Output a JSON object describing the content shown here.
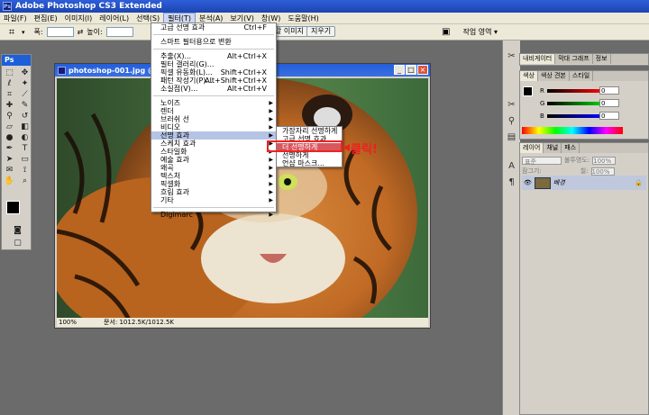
{
  "app": {
    "title": "Adobe Photoshop CS3 Extended",
    "logo": "Ps"
  },
  "menubar": [
    "파일(F)",
    "편집(E)",
    "이미지(I)",
    "레이어(L)",
    "선택(S)",
    "필터(T)",
    "분석(A)",
    "보기(V)",
    "창(W)",
    "도움말(H)"
  ],
  "options": {
    "width_label": "폭:",
    "height_label": "높이:",
    "front_image_btn": "앞 이미지",
    "clear_btn": "지우기",
    "workspace_label": "작업 영역 ▾"
  },
  "document": {
    "title": "photoshop-001.jpg @ 1",
    "zoom": "100%",
    "docsize": "문서: 1012.5K/1012.5K"
  },
  "filter_menu": {
    "items_top": [
      {
        "label": "고급 선명 효과",
        "shortcut": "Ctrl+F"
      }
    ],
    "items_smart": [
      {
        "label": "스마트 필터용으로 변환"
      }
    ],
    "items_special": [
      {
        "label": "추출(X)...",
        "shortcut": "Alt+Ctrl+X"
      },
      {
        "label": "필터 갤러리(G)..."
      },
      {
        "label": "픽셀 유동화(L)...",
        "shortcut": "Shift+Ctrl+X"
      },
      {
        "label": "패턴 작성기(P)...",
        "shortcut": "Alt+Shift+Ctrl+X"
      },
      {
        "label": "소실점(V)...",
        "shortcut": "Alt+Ctrl+V"
      }
    ],
    "items_groups": [
      "노이즈",
      "렌더",
      "브러쉬 선",
      "비디오",
      "선명 효과",
      "스케치 효과",
      "스타일화",
      "예술 효과",
      "왜곡",
      "텍스처",
      "픽셀화",
      "흐림 효과",
      "기타"
    ],
    "selected_group": "선명 효과",
    "items_bottom": [
      "Digimarc"
    ]
  },
  "submenu": {
    "items": [
      "가장자리 선명하게",
      "고급 선명 효과...",
      "더 선명하게",
      "선명하게",
      "언샵 마스크..."
    ],
    "selected": "더 선명하게"
  },
  "annotation": {
    "label": "클릭!",
    "color": "#ee2020"
  },
  "panels": {
    "nav_tabs": [
      "내비게이터",
      "막대 그래프",
      "정보"
    ],
    "color_tabs": [
      "색상",
      "색상 견본",
      "스타일"
    ],
    "color_sliders": [
      {
        "ch": "R",
        "value": "0"
      },
      {
        "ch": "G",
        "value": "0"
      },
      {
        "ch": "B",
        "value": "0"
      }
    ],
    "layer_tabs": [
      "레이어",
      "채널",
      "패스"
    ],
    "blend_mode": "표준",
    "opacity_label": "불투명도:",
    "opacity_value": "100%",
    "lock_label": "잠그기:",
    "fill_label": "칠:",
    "fill_value": "100%",
    "layer_name": "배경"
  }
}
